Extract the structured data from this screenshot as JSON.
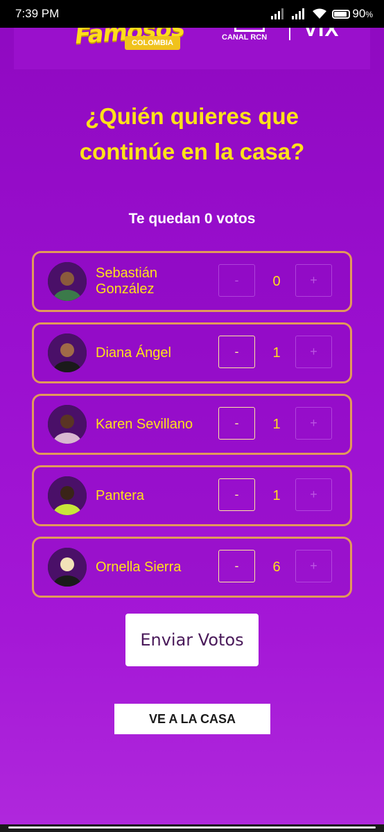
{
  "status_bar": {
    "time": "7:39 PM",
    "battery": "90"
  },
  "header": {
    "logo_famosos": "Famosos",
    "logo_colombia": "COLOMBIA",
    "logo_canal": "CANAL RCN",
    "logo_vix": "VIX"
  },
  "title_line1": "¿Quién quieres que",
  "title_line2": "continúe en la casa?",
  "votes_left": "Te quedan 0 votos",
  "contestants": [
    {
      "name": "Sebastián González",
      "votes": "0",
      "minus": "-",
      "plus": "+",
      "minus_enabled": false,
      "plus_enabled": false
    },
    {
      "name": "Diana Ángel",
      "votes": "1",
      "minus": "-",
      "plus": "+",
      "minus_enabled": true,
      "plus_enabled": false
    },
    {
      "name": "Karen Sevillano",
      "votes": "1",
      "minus": "-",
      "plus": "+",
      "minus_enabled": true,
      "plus_enabled": false
    },
    {
      "name": "Pantera",
      "votes": "1",
      "minus": "-",
      "plus": "+",
      "minus_enabled": true,
      "plus_enabled": false
    },
    {
      "name": "Ornella Sierra",
      "votes": "6",
      "minus": "-",
      "plus": "+",
      "minus_enabled": true,
      "plus_enabled": false
    }
  ],
  "send_button": "Enviar Votos",
  "house_button": "VE A LA CASA",
  "colors": {
    "accent_yellow": "#ffe11a",
    "card_border": "#e2995a",
    "background": "#9a0fcf"
  }
}
